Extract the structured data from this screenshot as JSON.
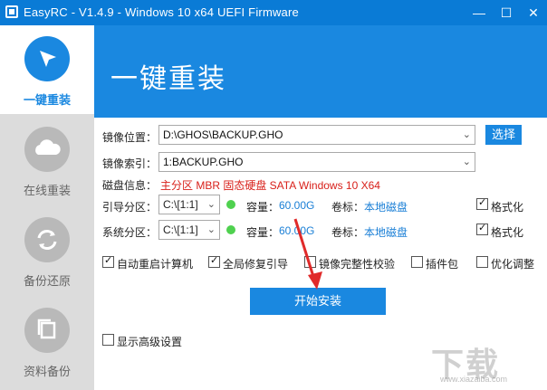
{
  "window": {
    "title": "EasyRC - V1.4.9 - Windows 10 x64 UEFI Firmware",
    "min": "—",
    "max": "☐",
    "close": "✕"
  },
  "sidebar": {
    "items": [
      {
        "label": "一键重装",
        "icon": "cursor-icon",
        "active": true
      },
      {
        "label": "在线重装",
        "icon": "cloud-icon",
        "active": false
      },
      {
        "label": "备份还原",
        "icon": "sync-icon",
        "active": false
      },
      {
        "label": "资料备份",
        "icon": "copy-icon",
        "active": false
      }
    ]
  },
  "banner": {
    "title": "一键重装"
  },
  "form": {
    "image_path_label": "镜像位置：",
    "image_path_value": "D:\\GHOS\\BACKUP.GHO",
    "browse_label": "选择",
    "image_index_label": "镜像索引：",
    "image_index_value": "1:BACKUP.GHO",
    "disk_info_label": "磁盘信息：",
    "disk_info_value": "主分区 MBR 固态硬盘 SATA Windows 10 X64",
    "boot_partition_label": "引导分区：",
    "boot_partition_value": "C:\\[1:1]",
    "system_partition_label": "系统分区：",
    "system_partition_value": "C:\\[1:1]",
    "capacity_label": "容量：",
    "capacity_value": "60.00G",
    "volume_label": "卷标：",
    "volume_value": "本地磁盘",
    "format_label": "格式化"
  },
  "options": [
    {
      "label": "自动重启计算机",
      "checked": true
    },
    {
      "label": "全局修复引导",
      "checked": true
    },
    {
      "label": "镜像完整性校验",
      "checked": false
    },
    {
      "label": "插件包",
      "checked": false
    },
    {
      "label": "优化调整",
      "checked": false
    }
  ],
  "install_button": "开始安装",
  "advanced_label": "显示高级设置",
  "watermark": {
    "text": "下载",
    "sub": "www.xiazaiba.com"
  },
  "colors": {
    "accent": "#1a88e0",
    "titlebar": "#0a7bd6",
    "disk_info": "#d8201a",
    "status_dot": "#4fd14f"
  }
}
